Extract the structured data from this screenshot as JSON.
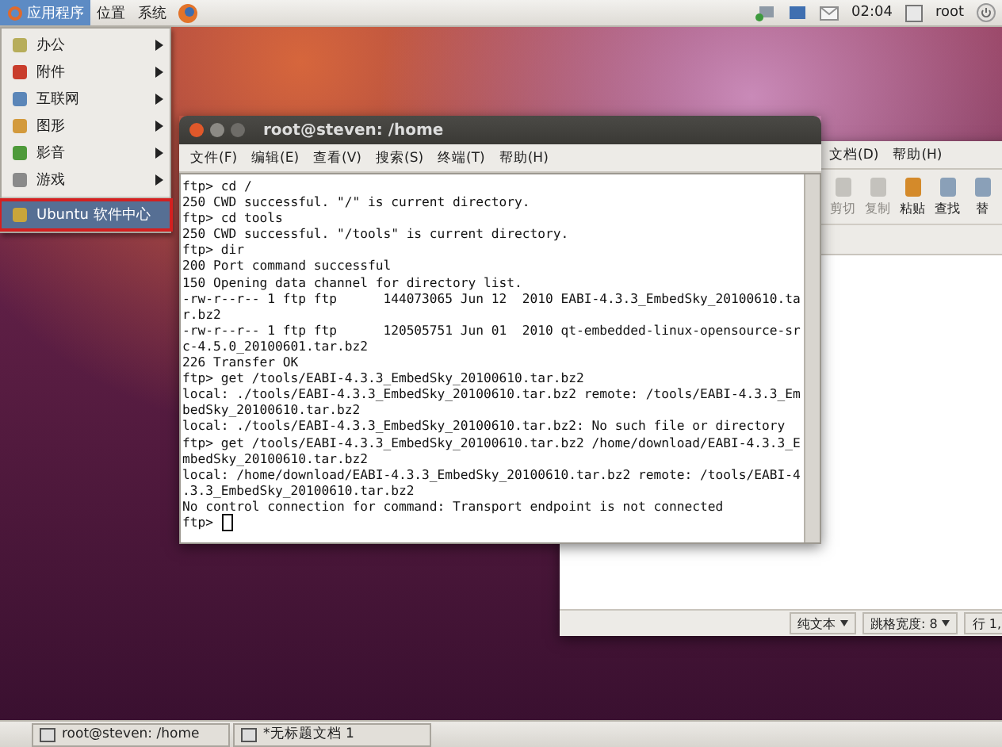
{
  "top_panel": {
    "menus": [
      {
        "label": "应用程序",
        "selected": true
      },
      {
        "label": "位置",
        "selected": false
      },
      {
        "label": "系统",
        "selected": false
      }
    ],
    "clock": "02:04",
    "user": "root"
  },
  "app_menu": {
    "items": [
      {
        "label": "办公",
        "has_submenu": true,
        "selected": false
      },
      {
        "label": "附件",
        "has_submenu": true,
        "selected": false
      },
      {
        "label": "互联网",
        "has_submenu": true,
        "selected": false
      },
      {
        "label": "图形",
        "has_submenu": true,
        "selected": false
      },
      {
        "label": "影音",
        "has_submenu": true,
        "selected": false
      },
      {
        "label": "游戏",
        "has_submenu": true,
        "selected": false
      },
      {
        "label": "Ubuntu 软件中心",
        "has_submenu": false,
        "selected": true
      }
    ]
  },
  "terminal": {
    "title": "root@steven: /home",
    "menus": [
      "文件(F)",
      "编辑(E)",
      "查看(V)",
      "搜索(S)",
      "终端(T)",
      "帮助(H)"
    ],
    "lines": [
      "ftp> cd /",
      "250 CWD successful. \"/\" is current directory.",
      "ftp> cd tools",
      "250 CWD successful. \"/tools\" is current directory.",
      "ftp> dir",
      "200 Port command successful",
      "150 Opening data channel for directory list.",
      "-rw-r--r-- 1 ftp ftp      144073065 Jun 12  2010 EABI-4.3.3_EmbedSky_20100610.ta",
      "r.bz2",
      "-rw-r--r-- 1 ftp ftp      120505751 Jun 01  2010 qt-embedded-linux-opensource-sr",
      "c-4.5.0_20100601.tar.bz2",
      "226 Transfer OK",
      "ftp> get /tools/EABI-4.3.3_EmbedSky_20100610.tar.bz2",
      "local: ./tools/EABI-4.3.3_EmbedSky_20100610.tar.bz2 remote: /tools/EABI-4.3.3_Em",
      "bedSky_20100610.tar.bz2",
      "local: ./tools/EABI-4.3.3_EmbedSky_20100610.tar.bz2: No such file or directory",
      "ftp> get /tools/EABI-4.3.3_EmbedSky_20100610.tar.bz2 /home/download/EABI-4.3.3_E",
      "mbedSky_20100610.tar.bz2",
      "local: /home/download/EABI-4.3.3_EmbedSky_20100610.tar.bz2 remote: /tools/EABI-4",
      ".3.3_EmbedSky_20100610.tar.bz2",
      "No control connection for command: Transport endpoint is not connected"
    ],
    "prompt": "ftp>"
  },
  "gedit": {
    "menus": [
      "文档(D)",
      "帮助(H)"
    ],
    "toolbar": [
      {
        "label": "剪切",
        "disabled": true
      },
      {
        "label": "复制",
        "disabled": true
      },
      {
        "label": "粘贴",
        "disabled": false
      },
      {
        "label": "查找",
        "disabled": false
      },
      {
        "label": "替",
        "disabled": false
      }
    ],
    "status": [
      "纯文本",
      "跳格宽度: 8",
      "行 1,"
    ]
  },
  "taskbar": [
    {
      "label": "root@steven: /home"
    },
    {
      "label": "*无标题文档 1"
    }
  ]
}
